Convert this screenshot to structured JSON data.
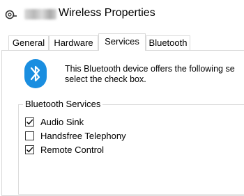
{
  "window": {
    "title": "Wireless Properties",
    "icon": "wireless-device-icon"
  },
  "tabs": [
    {
      "label": "General",
      "active": false
    },
    {
      "label": "Hardware",
      "active": false
    },
    {
      "label": "Services",
      "active": true
    },
    {
      "label": "Bluetooth",
      "active": false
    }
  ],
  "services_page": {
    "icon": "bluetooth-icon",
    "icon_color": "#1a8ee0",
    "description_line1": "This Bluetooth device offers the following se",
    "description_line2": "select the check box.",
    "group_label": "Bluetooth Services",
    "services": [
      {
        "label": "Audio Sink",
        "checked": true
      },
      {
        "label": "Handsfree Telephony",
        "checked": false
      },
      {
        "label": "Remote Control",
        "checked": true
      }
    ]
  }
}
